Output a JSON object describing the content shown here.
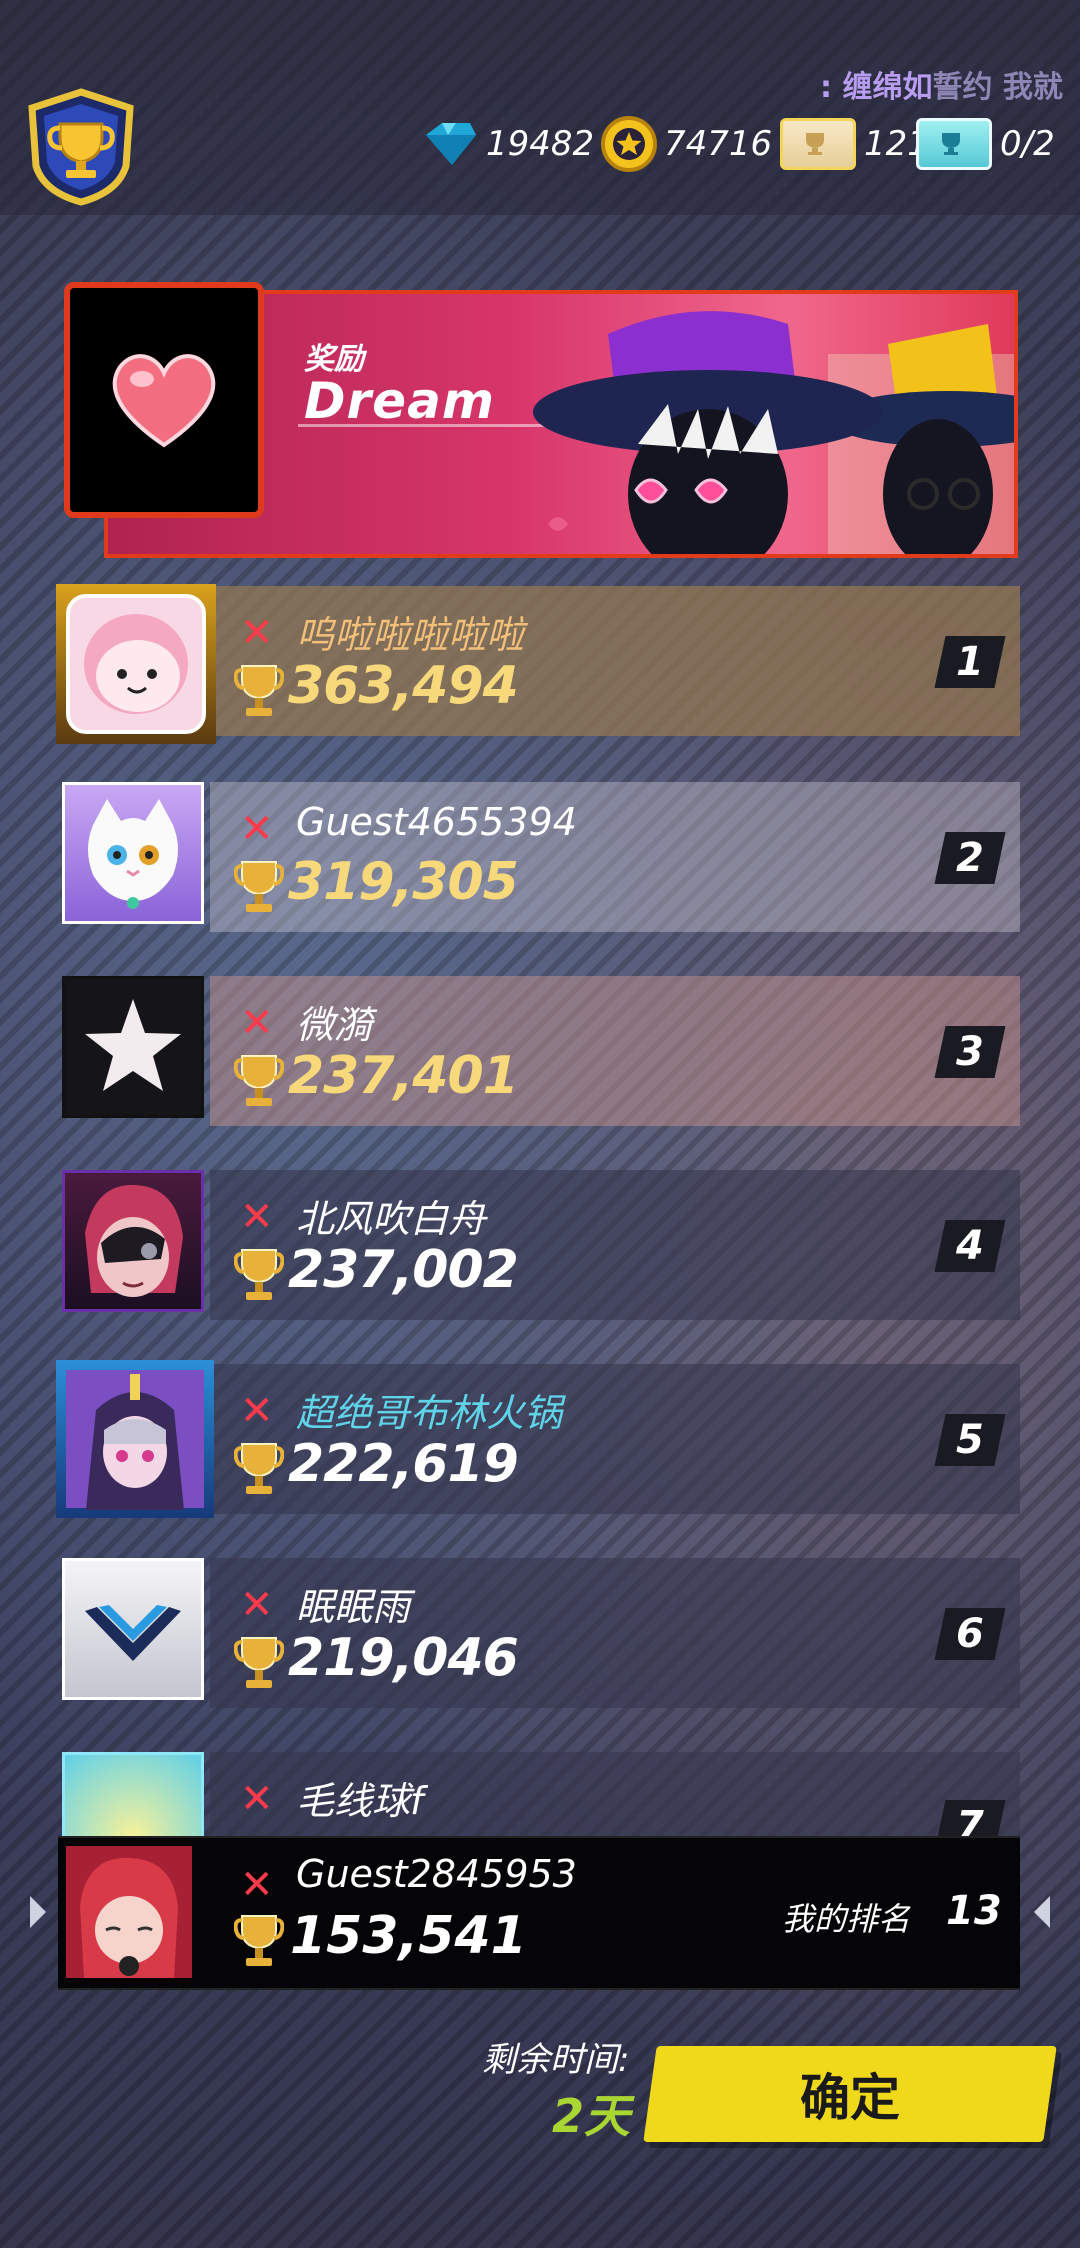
{
  "header": {
    "ticker_text_main": "缠绵如",
    "ticker_text_dim": "誓约 我就",
    "ticker_prefix": ":",
    "currencies": [
      {
        "icon": "diamond-icon",
        "value": "19482"
      },
      {
        "icon": "gold-coin-icon",
        "value": "74716"
      },
      {
        "icon": "gold-ticket-icon",
        "value": "121"
      },
      {
        "icon": "blue-ticket-icon",
        "value": "0/2"
      }
    ]
  },
  "reward": {
    "label": "奖励",
    "title": "Dream"
  },
  "rankings": [
    {
      "name": "呜啦啦啦啦啦",
      "score": "363,494",
      "rank": "1",
      "name_color": "#f3c07a"
    },
    {
      "name": "Guest4655394",
      "score": "319,305",
      "rank": "2",
      "name_color": "#ffffff"
    },
    {
      "name": "微漪",
      "score": "237,401",
      "rank": "3",
      "name_color": "#ffffff"
    },
    {
      "name": "北风吹白舟",
      "score": "237,002",
      "rank": "4",
      "name_color": "#ffffff"
    },
    {
      "name": "超绝哥布林火锅",
      "score": "222,619",
      "rank": "5",
      "name_color": "#5fd4e8"
    },
    {
      "name": "眠眠雨",
      "score": "219,046",
      "rank": "6",
      "name_color": "#ffffff"
    },
    {
      "name": "毛线球f",
      "score": "",
      "rank": "7",
      "name_color": "#ffffff"
    }
  ],
  "my_rank": {
    "name": "Guest2845953",
    "score": "153,541",
    "label": "我的排名",
    "rank": "13"
  },
  "footer": {
    "time_label": "剩余时间:",
    "time_value": "2天",
    "confirm_label": "确定"
  },
  "colors": {
    "gold_score": "#f7d87a",
    "accent_red": "#e03a1c",
    "confirm_yellow": "#f0d81a",
    "time_green": "#a9d633"
  }
}
